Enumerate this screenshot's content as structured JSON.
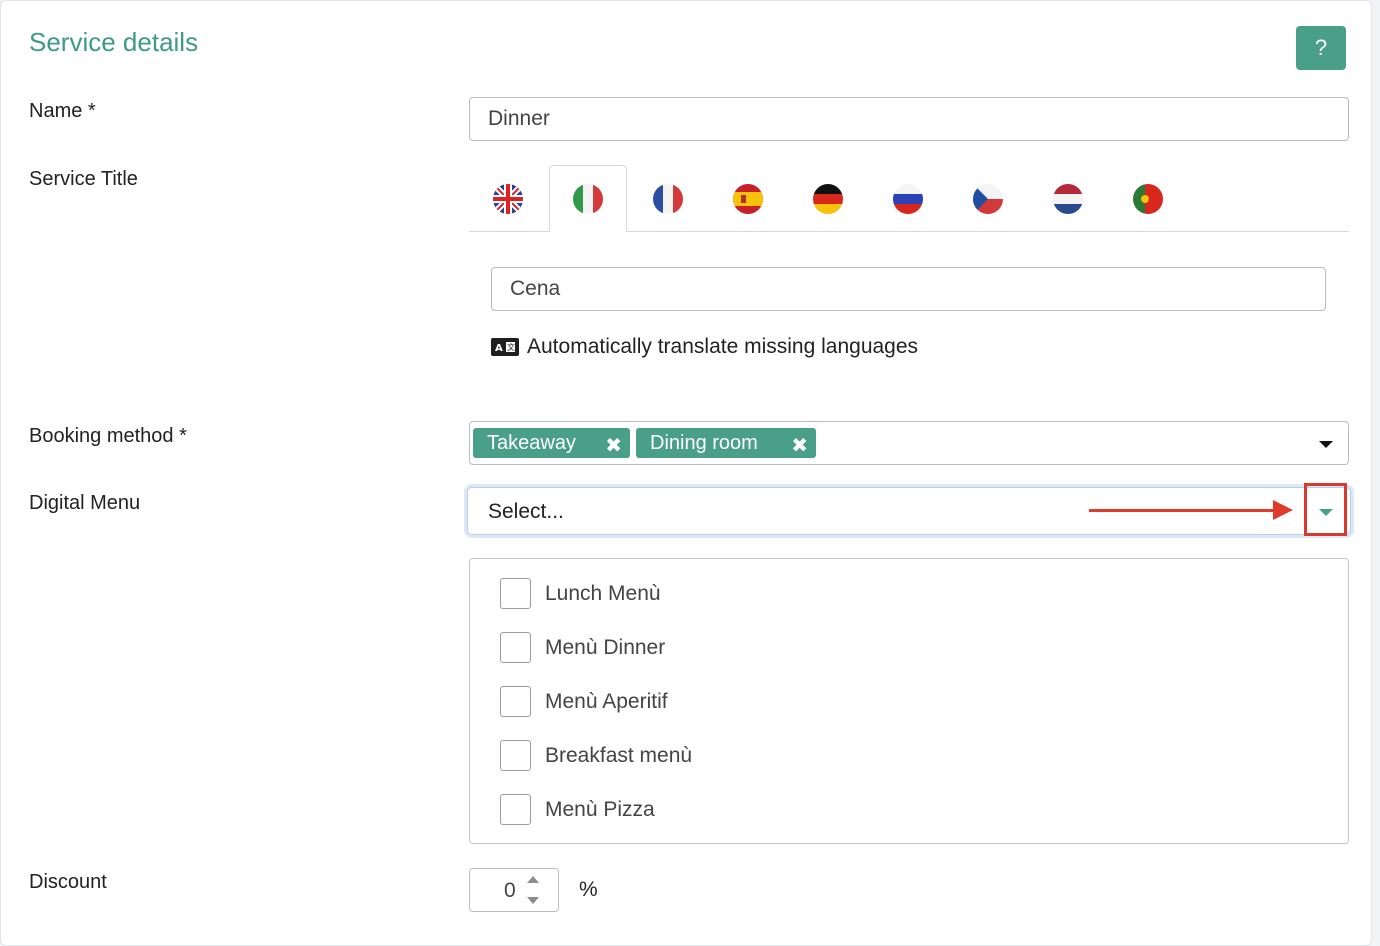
{
  "header": {
    "title": "Service details",
    "help_label": "?"
  },
  "fields": {
    "name": {
      "label": "Name  *",
      "value": "Dinner"
    },
    "service_title": {
      "label": "Service Title",
      "languages": [
        {
          "code": "en",
          "icon": "uk-flag-icon"
        },
        {
          "code": "it",
          "icon": "italy-flag-icon",
          "active": true
        },
        {
          "code": "fr",
          "icon": "france-flag-icon"
        },
        {
          "code": "es",
          "icon": "spain-flag-icon"
        },
        {
          "code": "de",
          "icon": "germany-flag-icon"
        },
        {
          "code": "ru",
          "icon": "russia-flag-icon"
        },
        {
          "code": "cz",
          "icon": "czech-flag-icon"
        },
        {
          "code": "nl",
          "icon": "netherlands-flag-icon"
        },
        {
          "code": "pt",
          "icon": "portugal-flag-icon"
        }
      ],
      "value": "Cena",
      "auto_translate_label": "Automatically translate missing languages"
    },
    "booking_method": {
      "label": "Booking method  *",
      "chips": [
        {
          "label": "Takeaway",
          "remove": "✖"
        },
        {
          "label": "Dining room",
          "remove": "✖"
        }
      ]
    },
    "digital_menu": {
      "label": "Digital Menu",
      "placeholder": "Select...",
      "options": [
        {
          "label": "Lunch Menù",
          "checked": false
        },
        {
          "label": "Menù Dinner",
          "checked": false
        },
        {
          "label": "Menù Aperitif",
          "checked": false
        },
        {
          "label": "Breakfast menù",
          "checked": false
        },
        {
          "label": "Menù Pizza",
          "checked": false
        }
      ]
    },
    "discount": {
      "label": "Discount",
      "value": "0",
      "unit": "%"
    }
  },
  "colors": {
    "accent": "#4a9f88",
    "title": "#3d9a85",
    "annotation": "#e03a2c"
  }
}
